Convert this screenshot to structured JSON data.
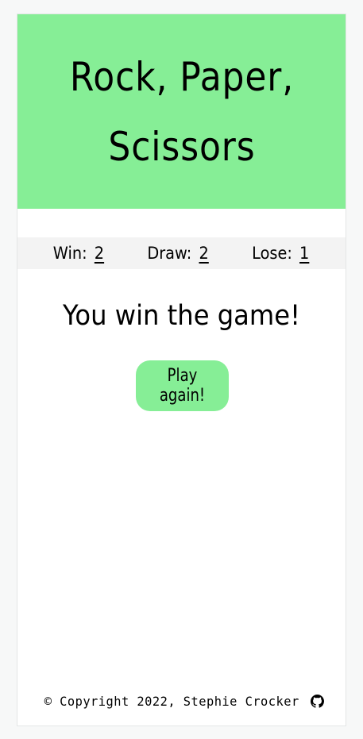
{
  "header": {
    "title": "Rock, Paper, Scissors"
  },
  "scores": {
    "win_label": "Win:",
    "win_value": "2",
    "draw_label": "Draw:",
    "draw_value": "2",
    "lose_label": "Lose:",
    "lose_value": "1"
  },
  "result": {
    "message": "You win the game!"
  },
  "actions": {
    "play_again_label": "Play again!"
  },
  "footer": {
    "copyright": "© Copyright 2022, Stephie Crocker",
    "icon": "github-icon"
  },
  "colors": {
    "accent": "#86ee96",
    "scorebar": "#f3f3f3",
    "background": "#f7f8f8"
  }
}
